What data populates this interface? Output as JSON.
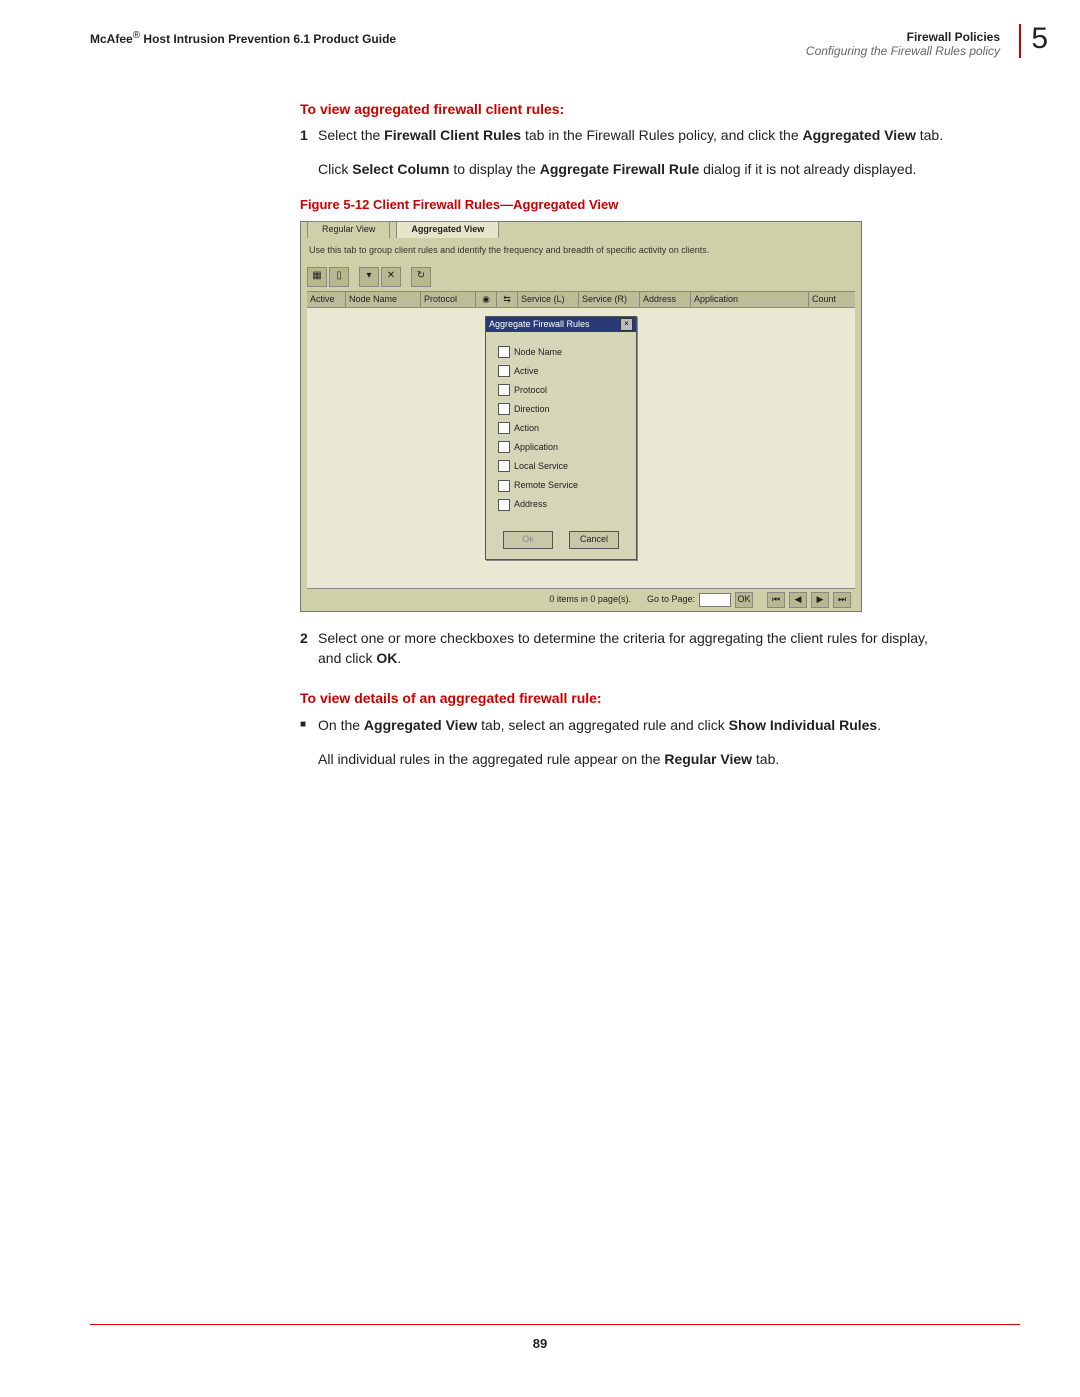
{
  "header": {
    "brand": "McAfee",
    "reg": "®",
    "product": "Host Intrusion Prevention 6.1 Product Guide",
    "section": "Firewall Policies",
    "subsection": "Configuring the Firewall Rules policy",
    "chapter": "5"
  },
  "sec1": {
    "heading": "To view aggregated firewall client rules:",
    "step1_num": "1",
    "step1_a": "Select the ",
    "step1_b": "Firewall Client Rules",
    "step1_c": " tab in the Firewall Rules policy, and click the ",
    "step1_d": "Aggregated View",
    "step1_e": " tab.",
    "step1_p2_a": "Click ",
    "step1_p2_b": "Select Column",
    "step1_p2_c": " to display the ",
    "step1_p2_d": "Aggregate Firewall Rule",
    "step1_p2_e": " dialog if it is not already displayed."
  },
  "figure": {
    "caption": "Figure 5-12  Client Firewall Rules—Aggregated View",
    "shot": {
      "tab_regular": "Regular View",
      "tab_aggregated": "Aggregated View",
      "hint": "Use this tab to group client rules and identify the frequency and breadth of specific activity on clients.",
      "columns": {
        "active": "Active",
        "node": "Node Name",
        "protocol": "Protocol",
        "svc_l": "Service (L)",
        "svc_r": "Service (R)",
        "address": "Address",
        "application": "Application",
        "count": "Count"
      },
      "dialog": {
        "title": "Aggregate Firewall Rules",
        "opts": {
          "node": "Node Name",
          "active": "Active",
          "protocol": "Protocol",
          "direction": "Direction",
          "action": "Action",
          "application": "Application",
          "lservice": "Local Service",
          "rservice": "Remote Service",
          "address": "Address"
        },
        "ok": "Ok",
        "cancel": "Cancel"
      },
      "footer": {
        "status": "0 items in 0 page(s).",
        "goto": "Go to Page:",
        "ok": "OK"
      }
    }
  },
  "sec1b": {
    "step2_num": "2",
    "step2_a": "Select one or more checkboxes to determine the criteria for aggregating the client rules for display, and click ",
    "step2_b": "OK",
    "step2_c": "."
  },
  "sec2": {
    "heading": "To view details of an aggregated firewall rule:",
    "b1_a": "On the ",
    "b1_b": "Aggregated View",
    "b1_c": " tab, select an aggregated rule and click ",
    "b1_d": "Show Individual Rules",
    "b1_e": ".",
    "p2_a": "All individual rules in the aggregated rule appear on the ",
    "p2_b": "Regular View",
    "p2_c": " tab."
  },
  "page_number": "89"
}
